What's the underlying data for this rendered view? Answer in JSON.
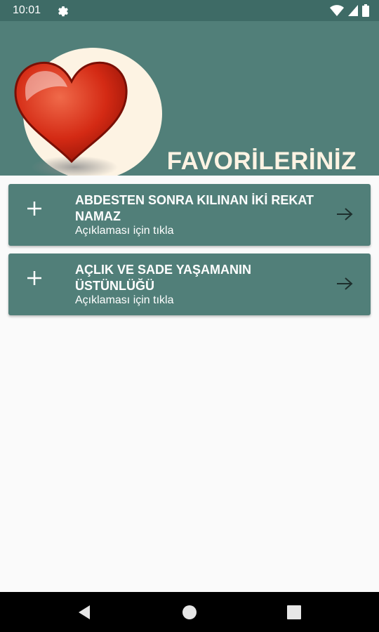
{
  "status_bar": {
    "time": "10:01",
    "icons": [
      "gear-icon",
      "wifi-icon",
      "signal-icon",
      "battery-icon"
    ]
  },
  "header": {
    "title": "FAVORİLERİNİZ",
    "image": "heart-icon"
  },
  "cards": [
    {
      "title": "ABDESTEN SONRA KILINAN İKİ REKAT NAMAZ",
      "subtitle": "Açıklaması için tıkla"
    },
    {
      "title": "AÇLIK VE SADE YAŞAMANIN ÜSTÜNLÜĞÜ",
      "subtitle": "Açıklaması için tıkla"
    }
  ],
  "nav": {
    "buttons": [
      "back-icon",
      "home-icon",
      "recents-icon"
    ]
  },
  "colors": {
    "primary": "#517f79",
    "status_bar": "#3e6b66",
    "accent_text": "#fdf3e3",
    "background": "#fafafa"
  }
}
